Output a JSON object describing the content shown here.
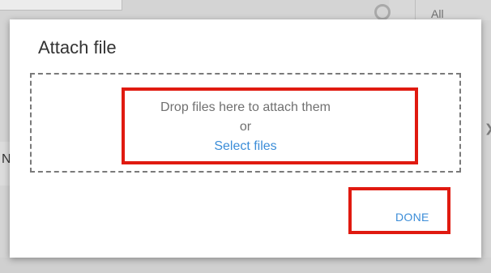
{
  "background": {
    "letter": "N",
    "filter_label": "All",
    "chevron_icon": "chevron-right-icon"
  },
  "dialog": {
    "title": "Attach file",
    "drop_text": "Drop files here to attach them",
    "or_text": "or",
    "select_link": "Select files",
    "done_label": "DONE"
  },
  "colors": {
    "link": "#3b8dd8",
    "highlight": "#e01a10",
    "text": "#333333",
    "muted_text": "#707070"
  }
}
